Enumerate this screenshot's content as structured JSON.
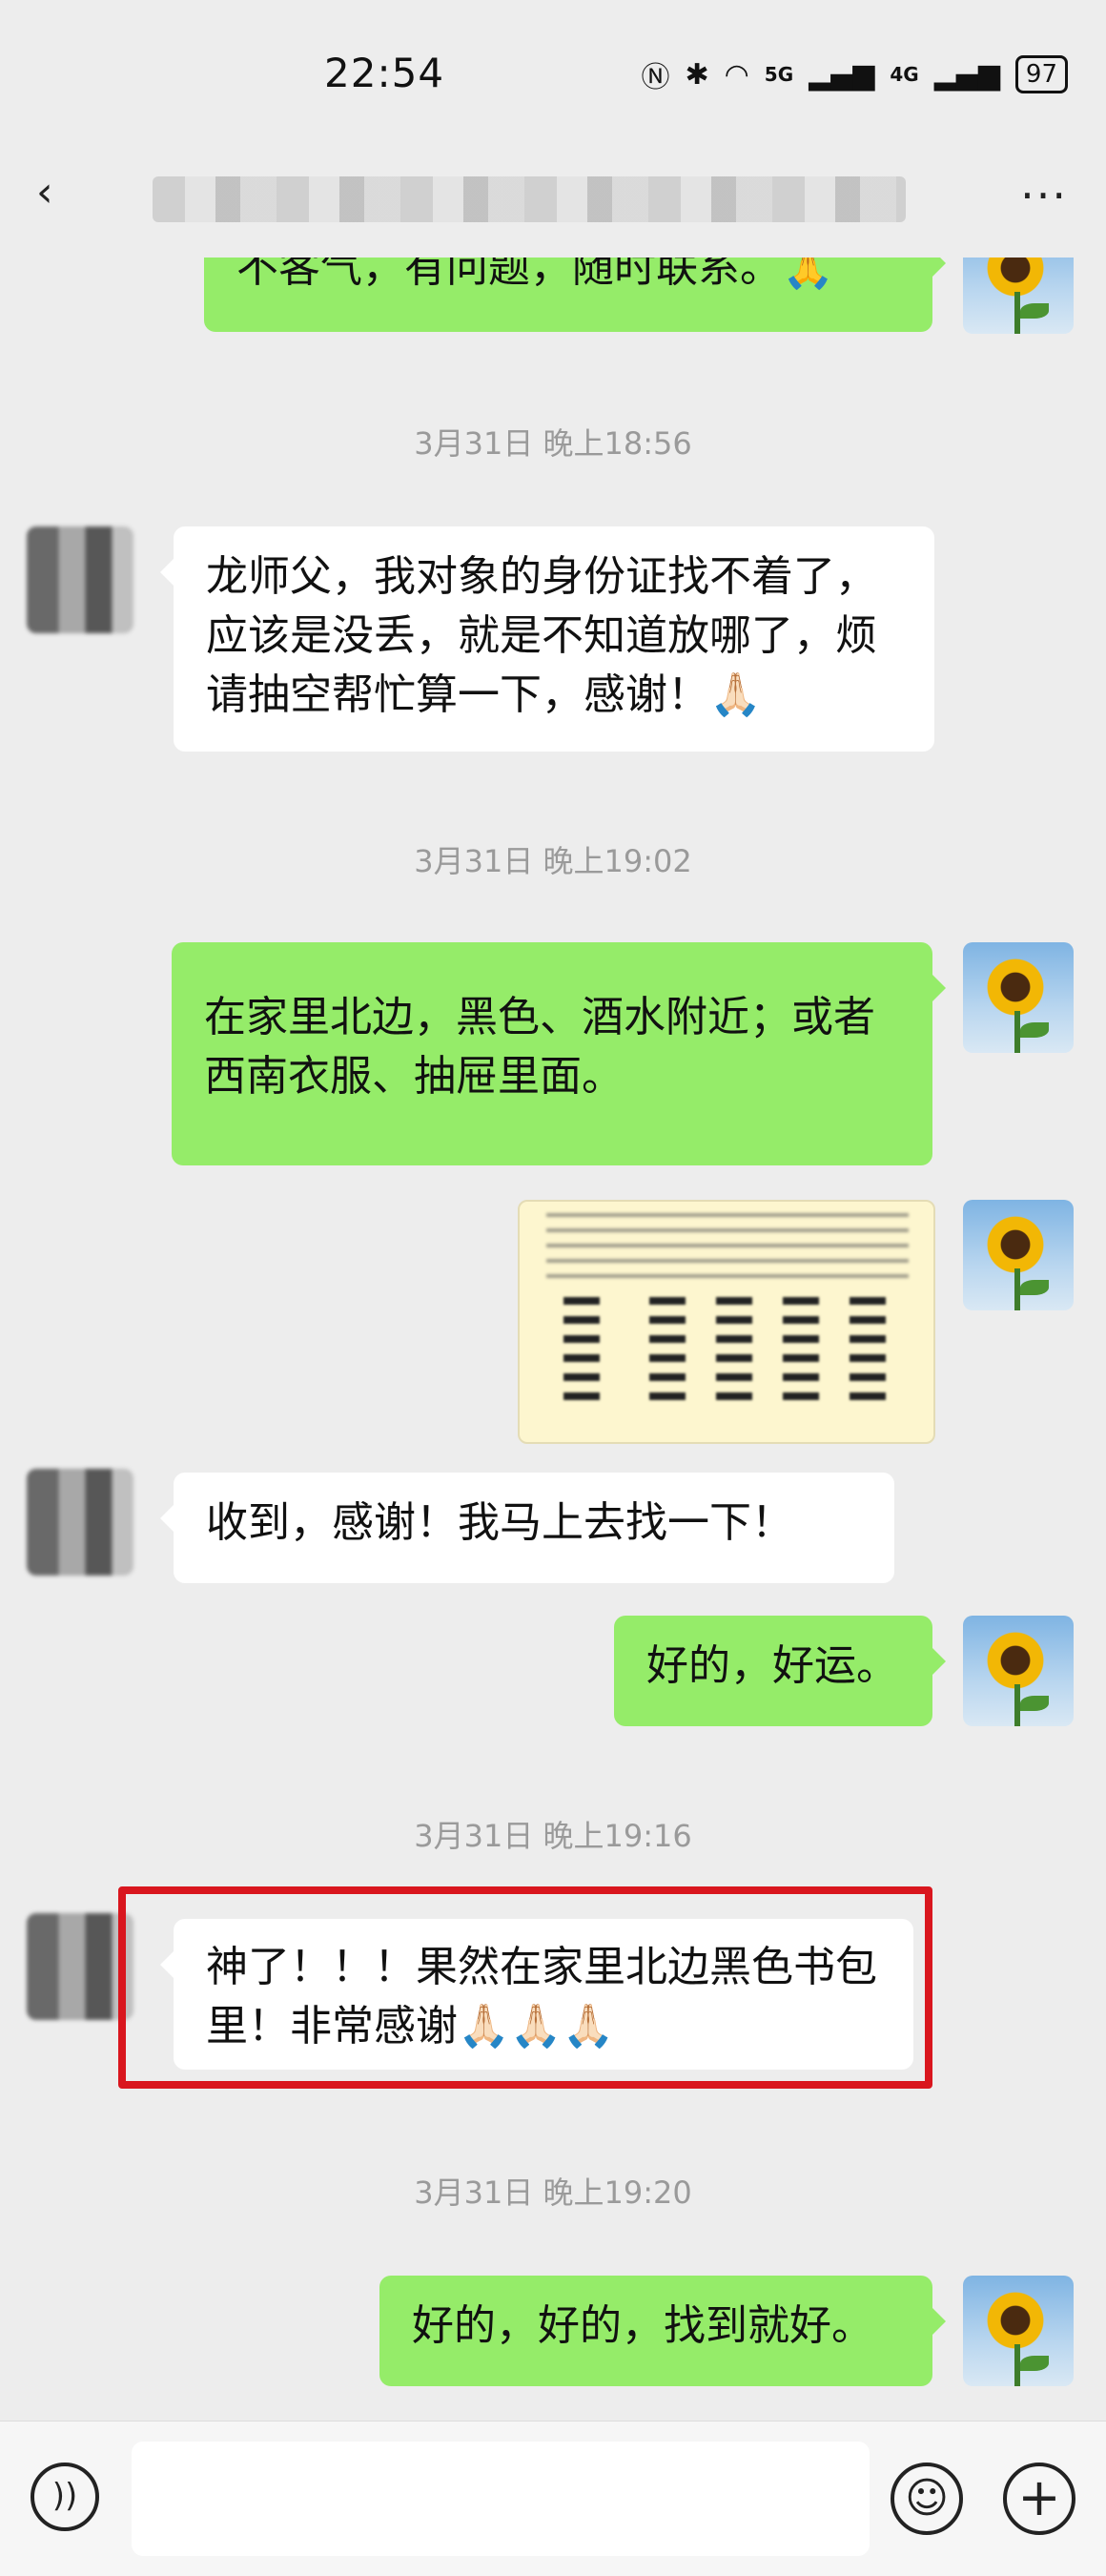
{
  "status_bar": {
    "time": "22:54",
    "nfc_icon": "nfc-icon",
    "bluetooth_icon": "bluetooth-icon",
    "wifi_icon": "wifi-icon",
    "sig1": "5G",
    "sig2": "4G",
    "battery": "97"
  },
  "title_bar": {
    "back_icon": "chevron-left-icon",
    "title": "",
    "more_label": "···"
  },
  "messages": [
    {
      "side": "out",
      "text": "不客气，有问题，随时联系。🙏"
    },
    {
      "type": "time",
      "text": "3月31日 晚上18:56"
    },
    {
      "side": "in",
      "text": "龙师父，我对象的身份证找不着了，应该是没丢，就是不知道放哪了，烦请抽空帮忙算一下，感谢！🙏🏻"
    },
    {
      "type": "time",
      "text": "3月31日 晚上19:02"
    },
    {
      "side": "out",
      "text": "在家里北边，黑色、酒水附近；或者西南衣服、抽屉里面。"
    },
    {
      "side": "out",
      "type": "image",
      "icon": "hexagram-image"
    },
    {
      "side": "in",
      "text": "收到，感谢！我马上去找一下！"
    },
    {
      "side": "out",
      "text": "好的，好运。"
    },
    {
      "type": "time",
      "text": "3月31日 晚上19:16"
    },
    {
      "side": "in",
      "text": "神了！！！果然在家里北边黑色书包里！非常感谢🙏🏻🙏🏻🙏🏻",
      "highlighted": true
    },
    {
      "type": "time",
      "text": "3月31日 晚上19:20"
    },
    {
      "side": "out",
      "text": "好的，好的，找到就好。"
    }
  ],
  "colors": {
    "background": "#ededed",
    "outgoing_bubble": "#95ec69",
    "incoming_bubble": "#ffffff",
    "highlight": "#d9161e"
  },
  "input_bar": {
    "voice_icon": "voice-icon",
    "input_value": "",
    "emoji_icon": "emoji-icon",
    "plus_icon": "plus-icon"
  }
}
